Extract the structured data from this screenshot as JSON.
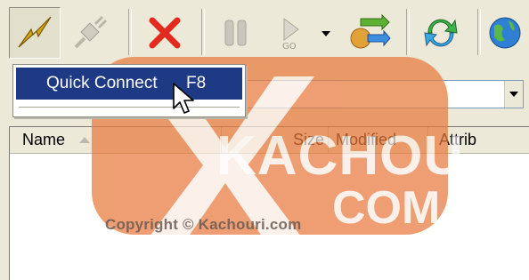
{
  "toolbar": {
    "buttons": [
      {
        "id": "quick-connect",
        "icon": "lightning-icon",
        "state": "pressed"
      },
      {
        "id": "disconnect",
        "icon": "plug-icon",
        "state": "disabled"
      },
      {
        "id": "abort",
        "icon": "red-x-icon",
        "state": "normal"
      },
      {
        "id": "pause",
        "icon": "pause-icon",
        "state": "disabled"
      },
      {
        "id": "go",
        "icon": "play-go-icon",
        "state": "disabled"
      },
      {
        "id": "transfer",
        "icon": "transfer-arrows-icon",
        "state": "normal"
      },
      {
        "id": "refresh",
        "icon": "refresh-icon",
        "state": "normal"
      },
      {
        "id": "web",
        "icon": "globe-icon",
        "state": "normal"
      }
    ]
  },
  "menu": {
    "item_label": "Quick Connect",
    "item_shortcut": "F8"
  },
  "file_list": {
    "columns": [
      "Name",
      "Size",
      "Modified",
      "Attrib"
    ]
  },
  "watermark": {
    "brand_line1": "KACHOURI",
    "brand_line2": "COM",
    "copyright": "Copyright © Kachouri.com"
  },
  "colors": {
    "menu_highlight": "#1f3a85",
    "watermark_orange": "#e87a3c"
  }
}
